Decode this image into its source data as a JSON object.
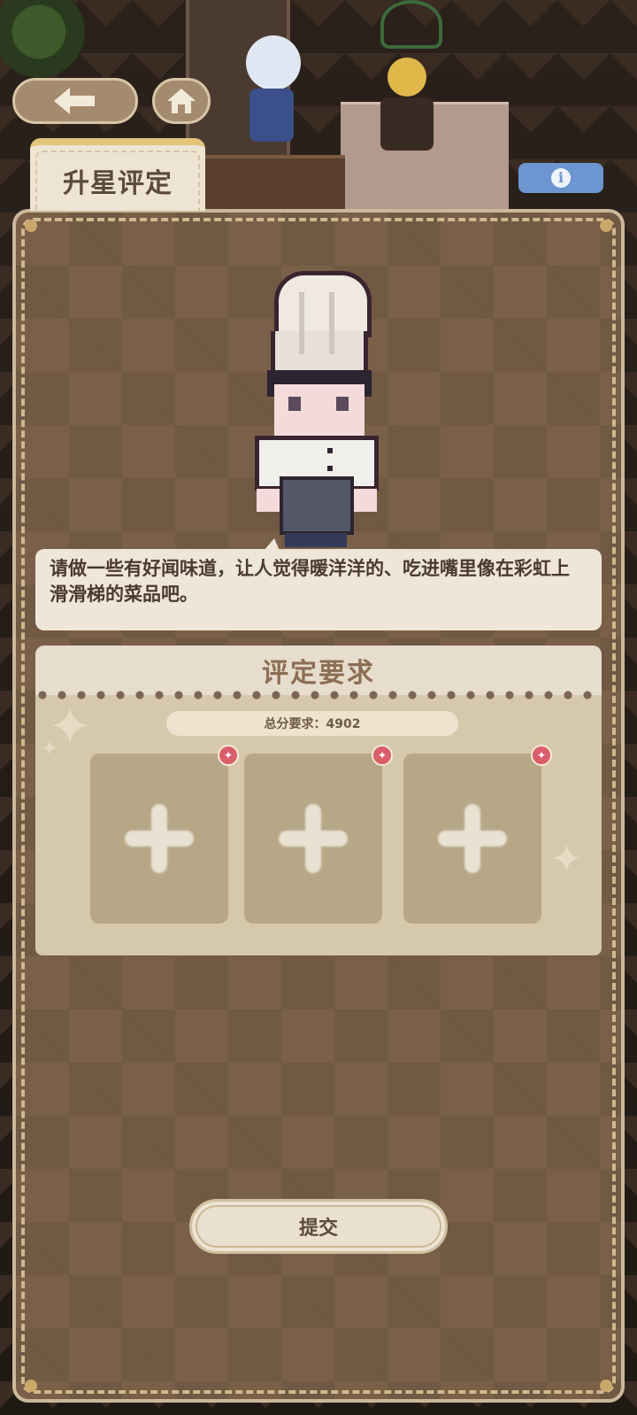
{
  "header": {
    "title": "升星评定",
    "back_icon": "arrow-left-icon",
    "home_icon": "home-icon",
    "info_icon": "info-icon",
    "info_glyph": "i"
  },
  "npc": {
    "sprite": "chef-character",
    "dialogue": "请做一些有好闻味道，让人觉得暖洋洋的、吃进嘴里像在彩虹上滑滑梯的菜品吧。"
  },
  "requirements": {
    "title": "评定要求",
    "total_score": "总分要求：4902",
    "slots": [
      {
        "icon": "add-icon",
        "badge": "✦"
      },
      {
        "icon": "add-icon",
        "badge": "✦"
      },
      {
        "icon": "add-icon",
        "badge": "✦"
      }
    ]
  },
  "submit": {
    "label": "提交"
  },
  "colors": {
    "panel": "#7a6048",
    "cream": "#eee6d9",
    "info_blue": "#6d95cf",
    "badge_red": "#d95e69",
    "title_gold": "#e2c47a"
  }
}
